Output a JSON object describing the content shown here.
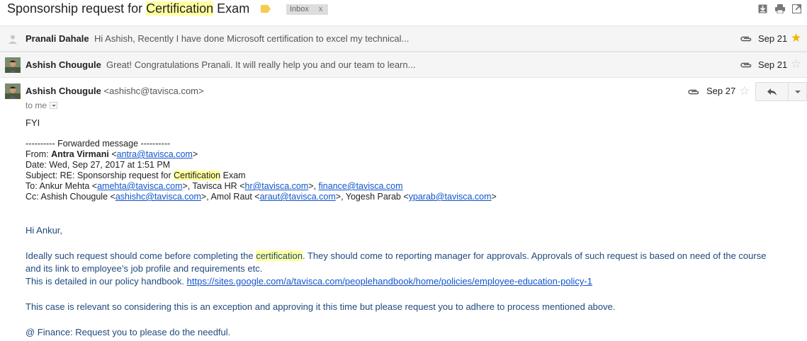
{
  "thread": {
    "subject_parts": [
      "Sponsorship request for ",
      "Certification",
      " Exam"
    ],
    "label": "Inbox",
    "label_remove": "x"
  },
  "messages": [
    {
      "sender": "Pranali Dahale",
      "snippet": "Hi Ashish, Recently I have done Microsoft certification to excel my technical...",
      "date": "Sep 21",
      "starred": true
    },
    {
      "sender": "Ashish Chougule",
      "snippet": "Great! Congratulations Pranali. It will really help you and our team to learn...",
      "date": "Sep 21",
      "starred": false
    }
  ],
  "open_message": {
    "sender_name": "Ashish Chougule",
    "sender_email": "<ashishc@tavisca.com>",
    "to": "to me",
    "date": "Sep 27",
    "intro": "FYI",
    "forwarded": {
      "divider": "---------- Forwarded message ----------",
      "from_label": "From: ",
      "from_name": "Antra Virmani",
      "from_email": "antra@tavisca.com",
      "date_line": "Date: Wed, Sep 27, 2017 at 1:51 PM",
      "subject_prefix": "Subject: RE: Sponsorship request for ",
      "subject_highlight": "Certification",
      "subject_suffix": " Exam",
      "to_label": "To: Ankur Mehta <",
      "to_email_1": "amehta@tavisca.com",
      "to_mid_1": ">, Tavisca HR <",
      "to_email_2": "hr@tavisca.com",
      "to_mid_2": ">, ",
      "to_email_3": "finance@tavisca.com",
      "cc_label": "Cc: Ashish Chougule <",
      "cc_email_1": "ashishc@tavisca.com",
      "cc_mid_1": ">, Amol Raut <",
      "cc_email_2": "araut@tavisca.com",
      "cc_mid_2": ">, Yogesh Parab <",
      "cc_email_3": "yparab@tavisca.com",
      "cc_end": ">"
    },
    "quoted": {
      "greeting": "Hi Ankur,",
      "p1_a": "Ideally such request should come before completing the ",
      "p1_hl": "certification",
      "p1_b": ". They should come to reporting manager for approvals. Approvals of such request is based on need of the course",
      "p1_c": "and its link to employee’s job profile and requirements etc.",
      "p2_a": "This is detailed in our policy handbook. ",
      "p2_link": "https://sites.google.com/a/tavisca.com/peoplehandbook/home/policies/employee-education-policy-1",
      "p3": "This case is relevant so considering this is an exception and approving it this time but please request you to adhere to process mentioned above.",
      "p4": "@ Finance: Request you to please do the needful."
    }
  },
  "colors": {
    "highlight": "#ffffa0",
    "link": "#1155cc",
    "quoted_text": "#1f497d",
    "star_on": "#f4b400",
    "star_off": "#cccccc"
  }
}
